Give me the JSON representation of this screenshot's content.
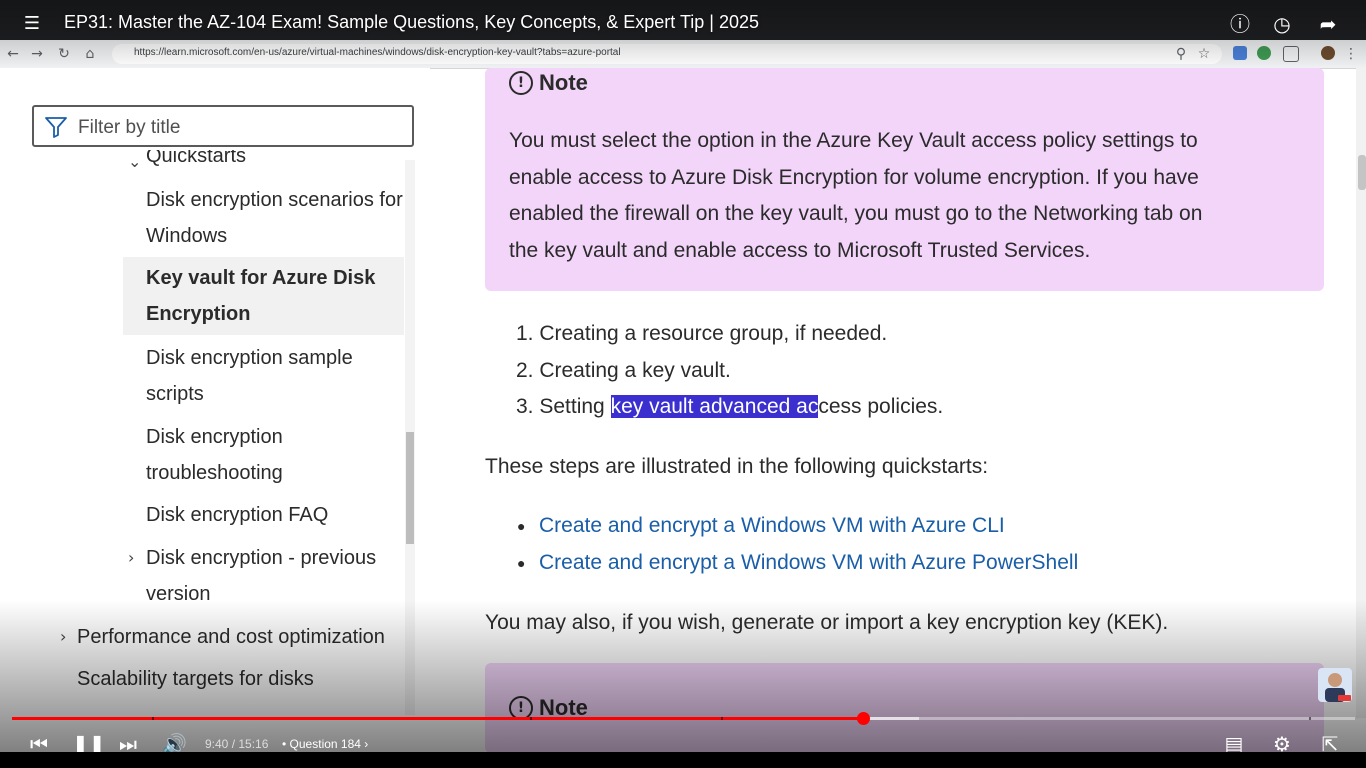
{
  "video": {
    "title": "EP31: Master the AZ-104 Exam! Sample Questions, Key Concepts, & Expert Tip | 2025",
    "time": "9:40 / 15:16",
    "chapter_separator": "•",
    "chapter": "Question 184",
    "played_fraction": 0.634,
    "buffered_fraction": 0.675
  },
  "browser": {
    "url": "https://learn.microsoft.com/en-us/azure/virtual-machines/windows/disk-encryption-key-vault?tabs=azure-portal"
  },
  "sidebar": {
    "filter_placeholder": "Filter by title",
    "items": [
      {
        "label": "Quickstarts"
      },
      {
        "label_line1": "Disk encryption scenarios for",
        "label_line2": "Windows"
      },
      {
        "label_line1": "Key vault for Azure Disk",
        "label_line2": "Encryption"
      },
      {
        "label_line1": "Disk encryption sample",
        "label_line2": "scripts"
      },
      {
        "label_line1": "Disk encryption",
        "label_line2": "troubleshooting"
      },
      {
        "label": "Disk encryption FAQ"
      },
      {
        "label_line1": "Disk encryption - previous",
        "label_line2": "version"
      },
      {
        "label": "Performance and cost optimization"
      },
      {
        "label": "Scalability targets for disks"
      }
    ]
  },
  "main": {
    "note1": {
      "title": "Note",
      "lines": [
        "You must select the option in the Azure Key Vault access policy settings to",
        "enable access to Azure Disk Encryption for volume encryption. If you have",
        "enabled the firewall on the key vault, you must go to the Networking tab on",
        "the key vault and enable access to Microsoft Trusted Services."
      ]
    },
    "steps": {
      "s1": "1. Creating a resource group, if needed.",
      "s2": "2. Creating a key vault.",
      "s3_pre": "3. Setting ",
      "s3_hl": "key vault advanced ac",
      "s3_post": "cess policies."
    },
    "quickstarts_intro": "These steps are illustrated in the following quickstarts:",
    "links": [
      "Create and encrypt a Windows VM with Azure CLI",
      "Create and encrypt a Windows VM with Azure PowerShell"
    ],
    "kek_text": "You may also, if you wish, generate or import a key encryption key (KEK).",
    "note2": {
      "title": "Note"
    }
  },
  "colors": {
    "note_bg": "#f2d5f9",
    "link": "#1a5ea8",
    "highlight": "#3b2fd0",
    "progress": "#ff0000"
  }
}
